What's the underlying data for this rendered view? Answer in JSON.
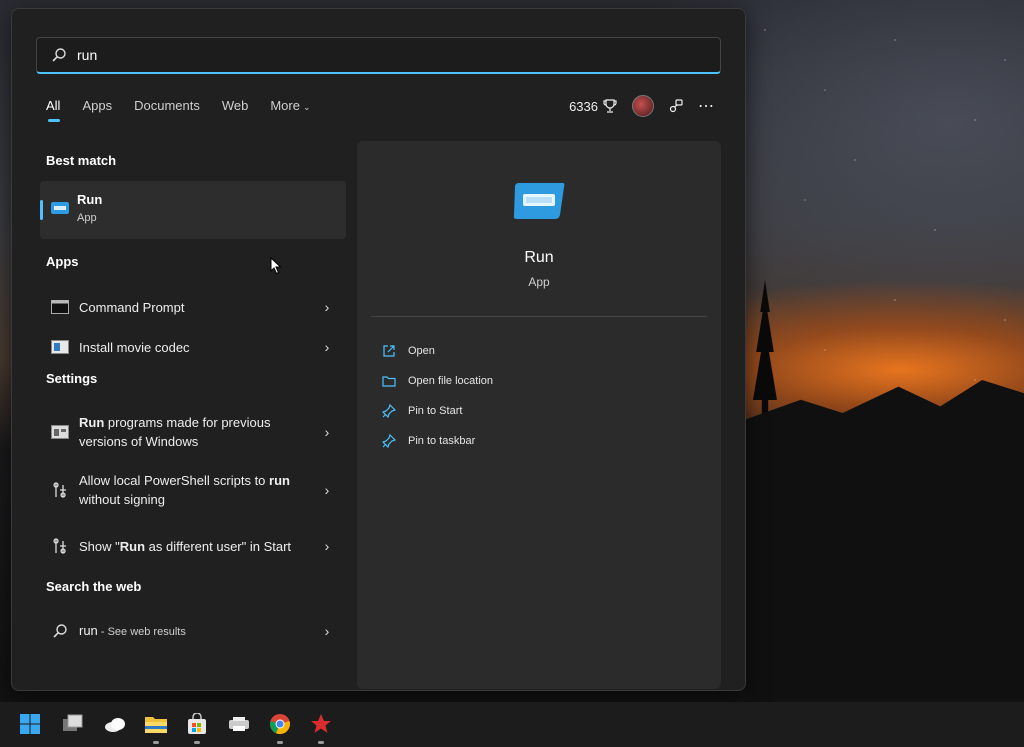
{
  "search": {
    "value": "run"
  },
  "tabs": [
    {
      "label": "All",
      "active": true
    },
    {
      "label": "Apps"
    },
    {
      "label": "Documents"
    },
    {
      "label": "Web"
    },
    {
      "label": "More"
    }
  ],
  "toolbar": {
    "points": "6336"
  },
  "sections": {
    "best_match": "Best match",
    "apps": "Apps",
    "settings": "Settings",
    "web": "Search the web"
  },
  "best_match": {
    "title": "Run",
    "subtitle": "App"
  },
  "apps": [
    {
      "label": "Command Prompt",
      "icon": "command-prompt-icon"
    },
    {
      "label": "Install movie codec",
      "icon": "app-window-icon"
    }
  ],
  "settings": [
    {
      "bold1": "Run",
      "text1": " programs made for previous versions of Windows"
    },
    {
      "text1": "Allow local PowerShell scripts to ",
      "bold1": "run",
      "text2": " without signing"
    },
    {
      "text1": "Show \"",
      "bold1": "Run",
      "text2": " as different user\" in Start"
    }
  ],
  "web_result": {
    "query": "run",
    "suffix": " - See web results"
  },
  "preview": {
    "title": "Run",
    "subtitle": "App",
    "actions": [
      {
        "label": "Open",
        "icon": "open-external-icon"
      },
      {
        "label": "Open file location",
        "icon": "folder-icon"
      },
      {
        "label": "Pin to Start",
        "icon": "pin-icon"
      },
      {
        "label": "Pin to taskbar",
        "icon": "pin-icon"
      }
    ]
  },
  "colors": {
    "accent": "#4cc2ff",
    "panel": "#202020",
    "preview_panel": "#2b2b2b"
  },
  "taskbar": {
    "icons": [
      "windows-start-icon",
      "task-view-icon",
      "weather-icon",
      "file-explorer-icon",
      "microsoft-store-icon",
      "printer-app-icon",
      "chrome-icon",
      "red-app-icon"
    ]
  }
}
